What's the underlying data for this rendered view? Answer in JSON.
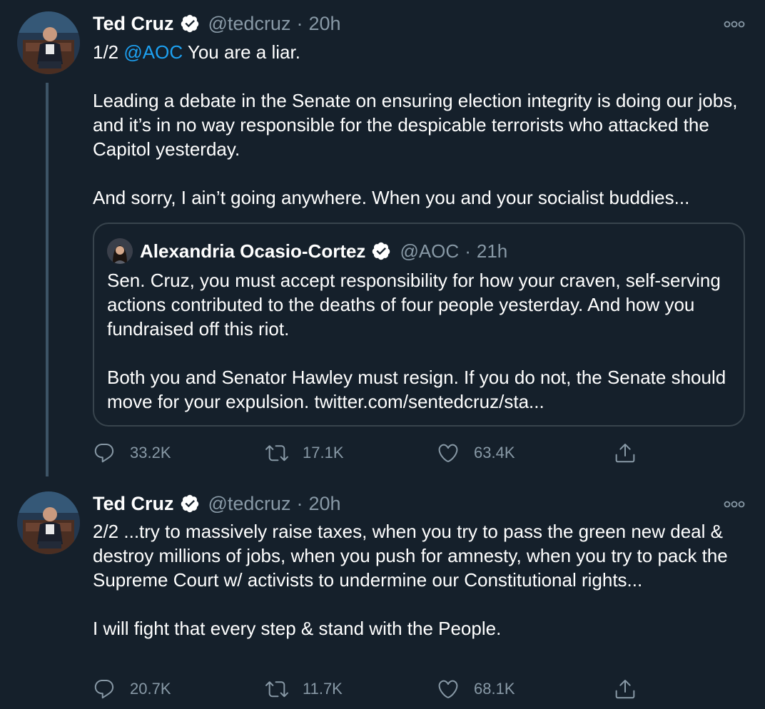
{
  "tweets": [
    {
      "author_name": "Ted Cruz",
      "handle": "@tedcruz",
      "separator": "·",
      "time": "20h",
      "text_prefix": "1/2 ",
      "mention": "@AOC",
      "text_line1_rest": " You are a liar.",
      "paragraph2": "Leading a debate in the Senate on ensuring election integrity is doing our jobs, and it’s in no way responsible for the despicable terrorists who attacked the Capitol yesterday.",
      "paragraph3": "And sorry, I ain’t going anywhere. When you and your socialist buddies...",
      "quoted": {
        "author_name": "Alexandria Ocasio-Cortez",
        "handle": "@AOC",
        "separator": "·",
        "time": "21h",
        "paragraph1": "Sen. Cruz, you must accept responsibility for how your craven, self-serving actions contributed to the deaths of four people yesterday. And how you fundraised off this riot.",
        "paragraph2": "Both you and Senator Hawley must resign. If you do not, the Senate should move for your expulsion. twitter.com/sentedcruz/sta..."
      },
      "replies": "33.2K",
      "retweets": "17.1K",
      "likes": "63.4K"
    },
    {
      "author_name": "Ted Cruz",
      "handle": "@tedcruz",
      "separator": "·",
      "time": "20h",
      "paragraph1": "2/2 ...try to massively raise taxes, when you try to pass the green new deal & destroy millions of jobs, when you push for amnesty, when you try to pack the Supreme Court w/ activists to undermine our Constitutional rights...",
      "paragraph2": "I will fight that every step & stand with the People.",
      "replies": "20.7K",
      "retweets": "11.7K",
      "likes": "68.1K"
    }
  ],
  "icons": {
    "verified": "verified-badge-icon",
    "more": "more-options-icon",
    "reply": "reply-icon",
    "retweet": "retweet-icon",
    "like": "heart-icon",
    "share": "share-icon"
  },
  "colors": {
    "background": "#15202b",
    "text": "#ffffff",
    "secondary": "#8899a6",
    "link": "#1da1f2",
    "border": "#38444d"
  }
}
